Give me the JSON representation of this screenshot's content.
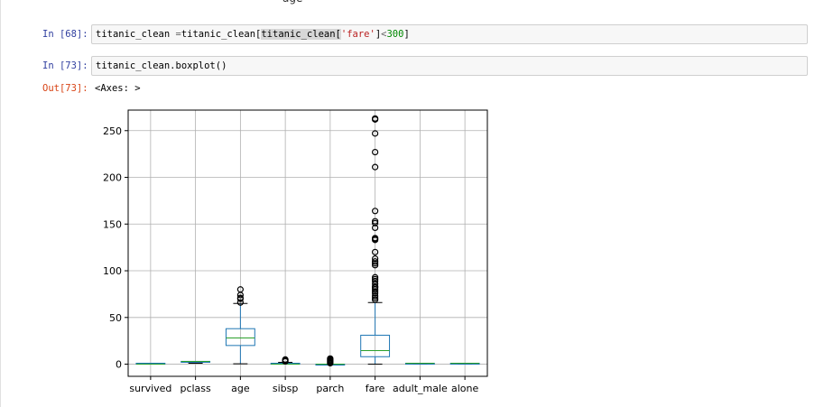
{
  "top_fragment": "age",
  "cells": [
    {
      "prompt": "In [68]:",
      "code_parts": [
        "titanic_clean ",
        "=",
        "titanic_clean[",
        "titanic_clean[",
        "'fare'",
        "]",
        "<",
        "300",
        "]"
      ]
    },
    {
      "prompt": "In [73]:",
      "code": "titanic_clean.boxplot()"
    }
  ],
  "output": {
    "prompt": "Out[73]:",
    "text": "<Axes: >"
  },
  "colors": {
    "box": "#1f77b4",
    "median": "#2ca02c",
    "grid": "#b0b0b0",
    "in_prompt": "#303f9f",
    "out_prompt": "#d84315"
  },
  "chart_data": {
    "type": "box",
    "title": "",
    "xlabel": "",
    "ylabel": "",
    "ylim": [
      -13,
      272
    ],
    "yticks": [
      0,
      50,
      100,
      150,
      200,
      250
    ],
    "ytick_labels": [
      "0",
      "50",
      "100",
      "150",
      "200",
      "250"
    ],
    "grid": true,
    "categories": [
      "survived",
      "pclass",
      "age",
      "sibsp",
      "parch",
      "fare",
      "adult_male",
      "alone"
    ],
    "boxes": [
      {
        "name": "survived",
        "whislo": 0,
        "q1": 0,
        "med": 0,
        "q3": 1,
        "whishi": 1,
        "fliers": []
      },
      {
        "name": "pclass",
        "whislo": 1,
        "q1": 2,
        "med": 3,
        "q3": 3,
        "whishi": 3,
        "fliers": []
      },
      {
        "name": "age",
        "whislo": 0.4,
        "q1": 20,
        "med": 28,
        "q3": 38,
        "whishi": 65,
        "fliers": [
          66,
          70,
          71,
          74,
          80
        ]
      },
      {
        "name": "sibsp",
        "whislo": 0,
        "q1": 0,
        "med": 0,
        "q3": 1,
        "whishi": 2,
        "fliers": [
          3,
          4,
          5
        ]
      },
      {
        "name": "parch",
        "whislo": 0,
        "q1": 0,
        "med": 0,
        "q3": 0,
        "whishi": 0,
        "fliers": [
          1,
          2,
          3,
          4,
          5,
          6
        ]
      },
      {
        "name": "fare",
        "whislo": 0,
        "q1": 8,
        "med": 14.5,
        "q3": 31,
        "whishi": 66,
        "fliers": [
          69,
          71,
          73,
          76,
          78,
          80,
          82,
          83,
          86,
          89,
          91,
          93,
          106,
          108,
          110,
          113,
          120,
          133,
          134,
          135,
          146,
          151,
          153,
          164,
          211,
          227,
          247,
          262,
          263
        ]
      },
      {
        "name": "adult_male",
        "whislo": 0,
        "q1": 0,
        "med": 1,
        "q3": 1,
        "whishi": 1,
        "fliers": []
      },
      {
        "name": "alone",
        "whislo": 0,
        "q1": 0,
        "med": 1,
        "q3": 1,
        "whishi": 1,
        "fliers": []
      }
    ]
  }
}
